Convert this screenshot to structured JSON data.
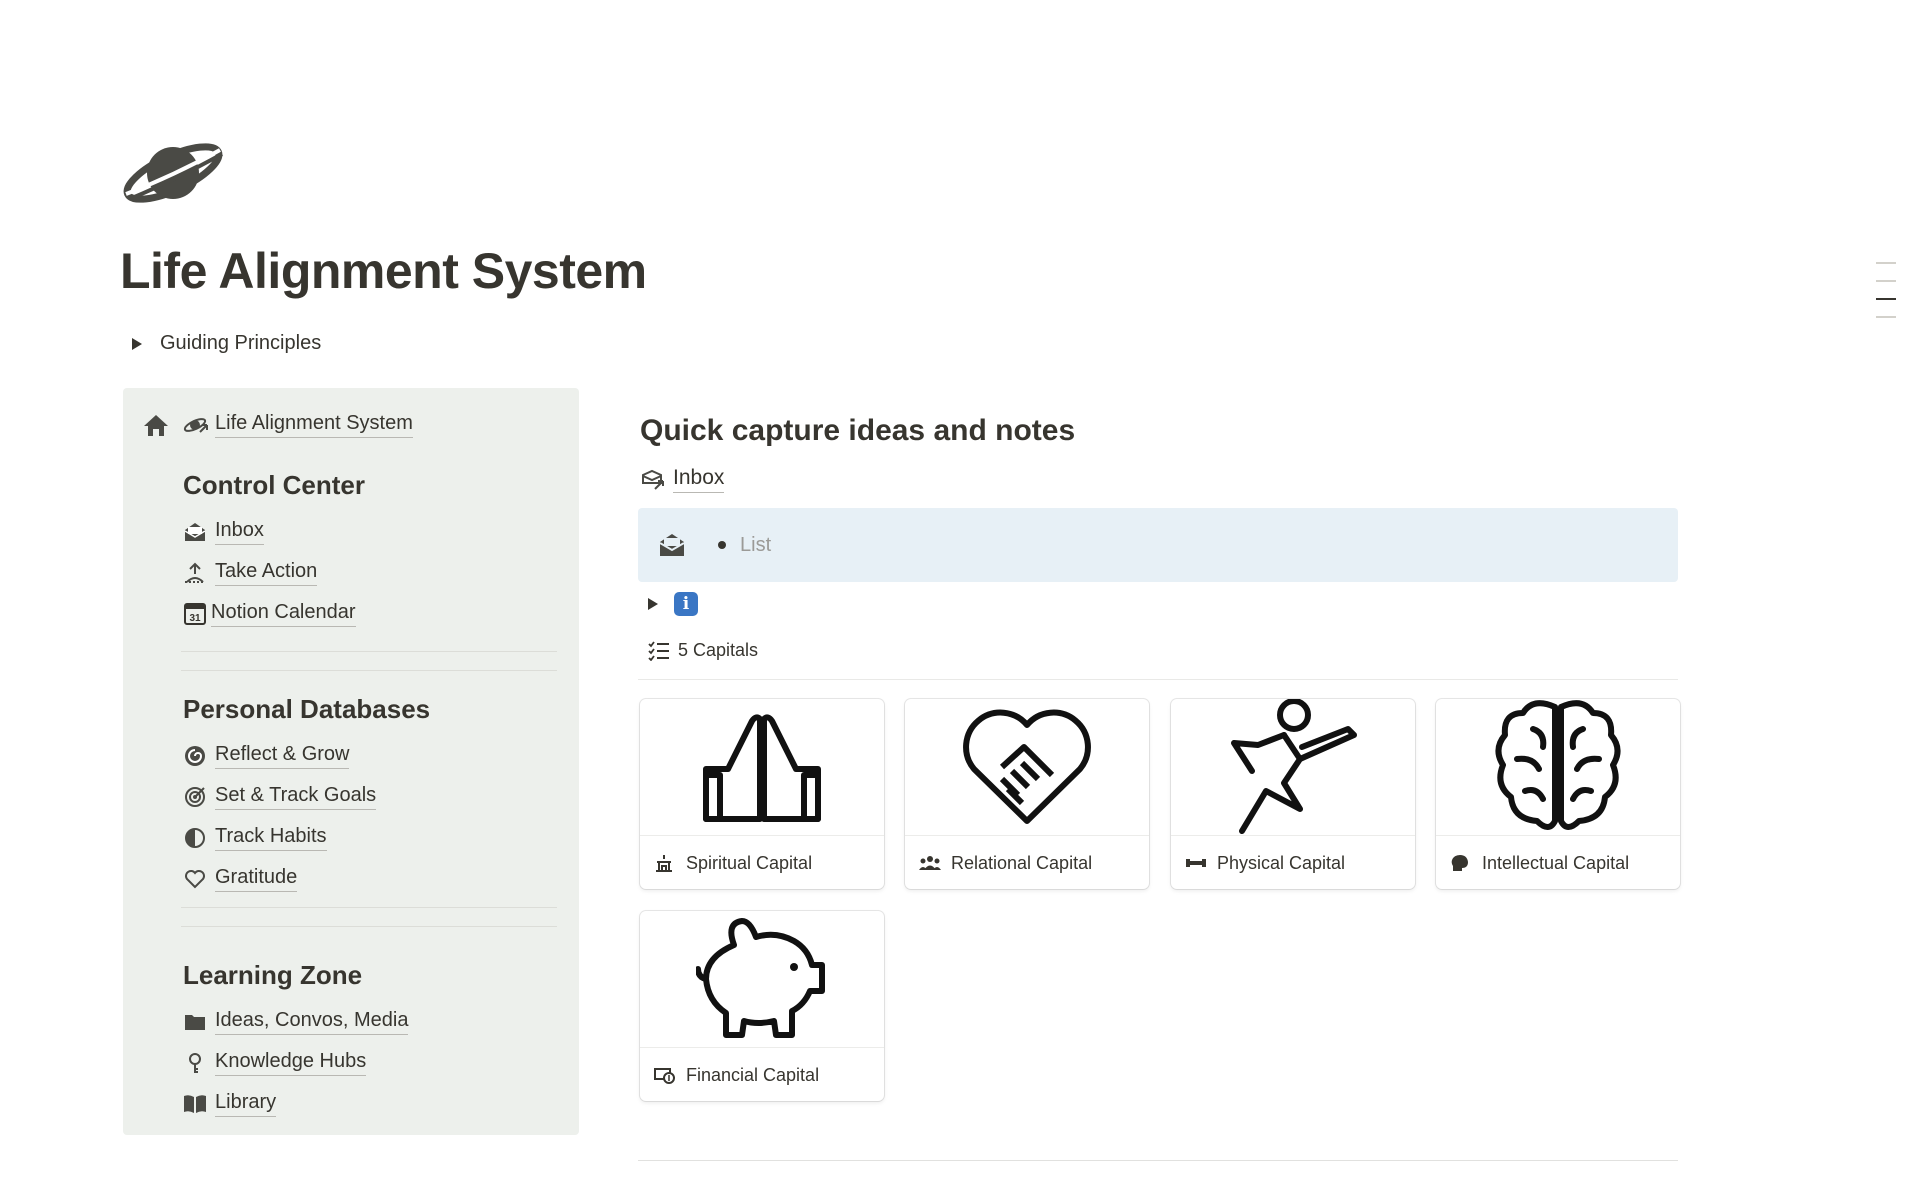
{
  "page": {
    "icon": "planet-icon",
    "title": "Life Alignment System",
    "toggle_label": "Guiding Principles"
  },
  "nav": {
    "home_icon": "home-icon",
    "root_link": "Life Alignment System",
    "sections": [
      {
        "heading": "Control Center",
        "items": [
          {
            "label": "Inbox",
            "icon": "envelope-open-icon"
          },
          {
            "label": "Take Action",
            "icon": "person-arrow-up-icon"
          },
          {
            "label": "Notion Calendar",
            "icon": "calendar-icon"
          }
        ]
      },
      {
        "heading": "Personal Databases",
        "items": [
          {
            "label": "Reflect & Grow",
            "icon": "spiral-icon"
          },
          {
            "label": "Set & Track Goals",
            "icon": "target-icon"
          },
          {
            "label": "Track Habits",
            "icon": "half-circle-icon"
          },
          {
            "label": "Gratitude",
            "icon": "heart-icon"
          }
        ]
      },
      {
        "heading": "Learning Zone",
        "items": [
          {
            "label": "Ideas, Convos, Media",
            "icon": "folder-icon"
          },
          {
            "label": "Knowledge Hubs",
            "icon": "key-icon"
          },
          {
            "label": "Library",
            "icon": "book-icon"
          }
        ]
      }
    ]
  },
  "main": {
    "heading": "Quick capture ideas and notes",
    "inbox_link": "Inbox",
    "list_placeholder": "List",
    "info_icon": "information-icon",
    "database_title": "5 Capitals",
    "cards": [
      {
        "label": "Spiritual Capital",
        "image_icon": "praying-hands-icon",
        "icon": "temple-icon"
      },
      {
        "label": "Relational Capital",
        "image_icon": "heart-handshake-icon",
        "icon": "group-icon"
      },
      {
        "label": "Physical Capital",
        "image_icon": "martial-arts-kick-icon",
        "icon": "dumbbell-icon"
      },
      {
        "label": "Intellectual Capital",
        "image_icon": "brain-icon",
        "icon": "head-icon"
      },
      {
        "label": "Financial Capital",
        "image_icon": "piggy-bank-icon",
        "icon": "money-icon"
      }
    ]
  }
}
